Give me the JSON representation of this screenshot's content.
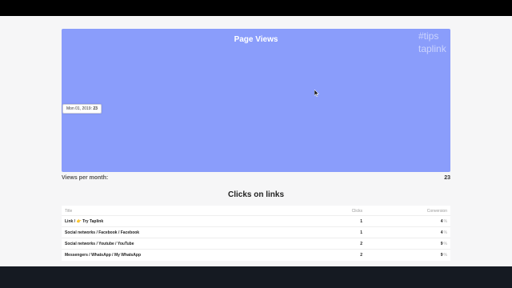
{
  "watermark": {
    "line1": "#tips",
    "line2": "taplink"
  },
  "chart": {
    "title": "Page Views",
    "tooltip_date": "Mon 01, 2019:",
    "tooltip_value": "23",
    "background": "#8a9dfb"
  },
  "chart_data": {
    "type": "line",
    "title": "Page Views",
    "x": [
      "Mon 01, 2019"
    ],
    "series": [
      {
        "values": [
          23
        ]
      }
    ]
  },
  "summary": {
    "label": "Views per month:",
    "value": "23"
  },
  "links": {
    "title": "Clicks on links",
    "columns": {
      "title": "Title",
      "clicks": "Clicks",
      "conversion": "Conversion"
    },
    "rows": [
      {
        "title_prefix": "Link / ",
        "icon": "👉",
        "title_rest": " Try Taplink",
        "clicks": "1",
        "conversion": "4",
        "unit": "%"
      },
      {
        "title_prefix": "Social networks / Facebook / Facebook",
        "icon": "",
        "title_rest": "",
        "clicks": "1",
        "conversion": "4",
        "unit": "%"
      },
      {
        "title_prefix": "Social networks / Youtube / YouTube",
        "icon": "",
        "title_rest": "",
        "clicks": "2",
        "conversion": "9",
        "unit": "%"
      },
      {
        "title_prefix": "Messengers / WhatsApp / My WhatsApp",
        "icon": "",
        "title_rest": "",
        "clicks": "2",
        "conversion": "9",
        "unit": "%"
      }
    ]
  }
}
